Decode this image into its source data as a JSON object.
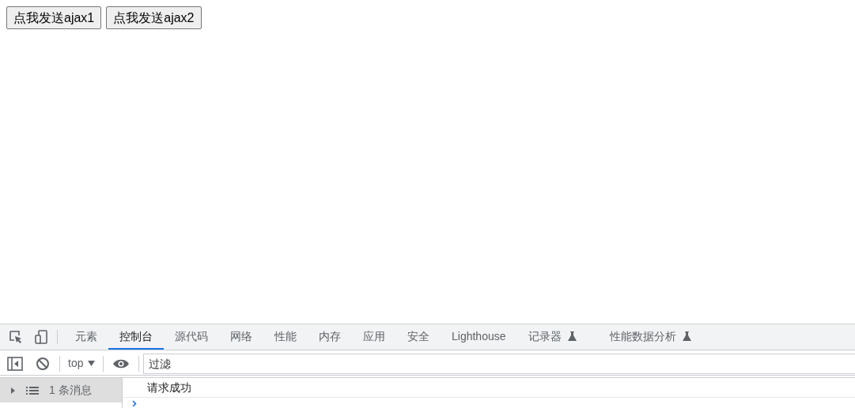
{
  "page": {
    "buttons": [
      "点我发送ajax1",
      "点我发送ajax2"
    ]
  },
  "devtools": {
    "tabs": [
      {
        "label": "元素",
        "selected": false,
        "experimental": false
      },
      {
        "label": "控制台",
        "selected": true,
        "experimental": false
      },
      {
        "label": "源代码",
        "selected": false,
        "experimental": false
      },
      {
        "label": "网络",
        "selected": false,
        "experimental": false
      },
      {
        "label": "性能",
        "selected": false,
        "experimental": false
      },
      {
        "label": "内存",
        "selected": false,
        "experimental": false
      },
      {
        "label": "应用",
        "selected": false,
        "experimental": false
      },
      {
        "label": "安全",
        "selected": false,
        "experimental": false
      },
      {
        "label": "Lighthouse",
        "selected": false,
        "experimental": false
      },
      {
        "label": "记录器",
        "selected": false,
        "experimental": true
      },
      {
        "label": "性能数据分析",
        "selected": false,
        "experimental": true
      }
    ],
    "toolbar": {
      "context": "top",
      "filter": {
        "placeholder": "过滤"
      }
    },
    "sidebar": {
      "items": [
        {
          "label": "1 条消息",
          "selected": true,
          "expanded": false
        }
      ]
    },
    "console": {
      "messages": [
        "请求成功"
      ]
    }
  }
}
